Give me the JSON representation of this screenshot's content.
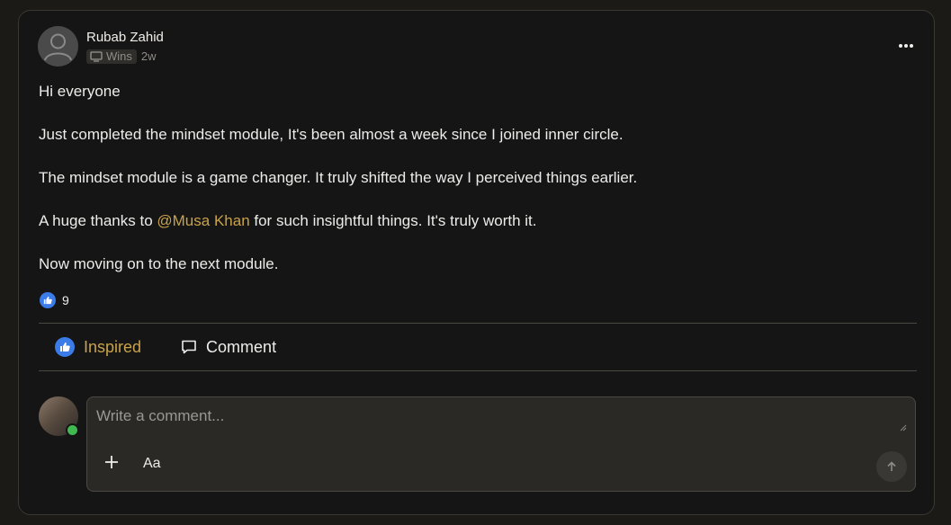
{
  "post": {
    "author": "Rubab Zahid",
    "category": "Wins",
    "time": "2w",
    "paragraphs": [
      "Hi everyone",
      "Just completed the mindset module, It's been almost a week since I joined inner circle.",
      "The mindset module is a game changer. It truly shifted the way I perceived things earlier."
    ],
    "thanks_before": "A huge thanks to ",
    "mention": "@Musa Khan",
    "thanks_after": " for such insightful things. It's truly worth it.",
    "closing": "Now moving on to the next module.",
    "reaction_count": "9"
  },
  "actions": {
    "inspired_label": "Inspired",
    "comment_label": "Comment"
  },
  "composer": {
    "placeholder": "Write a comment...",
    "format_label": "Aa"
  },
  "colors": {
    "accent": "#c9a24a",
    "like": "#3b7ce8",
    "online": "#3fb950"
  },
  "icons": {
    "more": "more-horizontal-icon",
    "tag": "monitor-icon",
    "like": "thumbs-up-icon",
    "comment": "comment-bubble-icon",
    "plus": "plus-icon",
    "send": "arrow-up-icon"
  }
}
